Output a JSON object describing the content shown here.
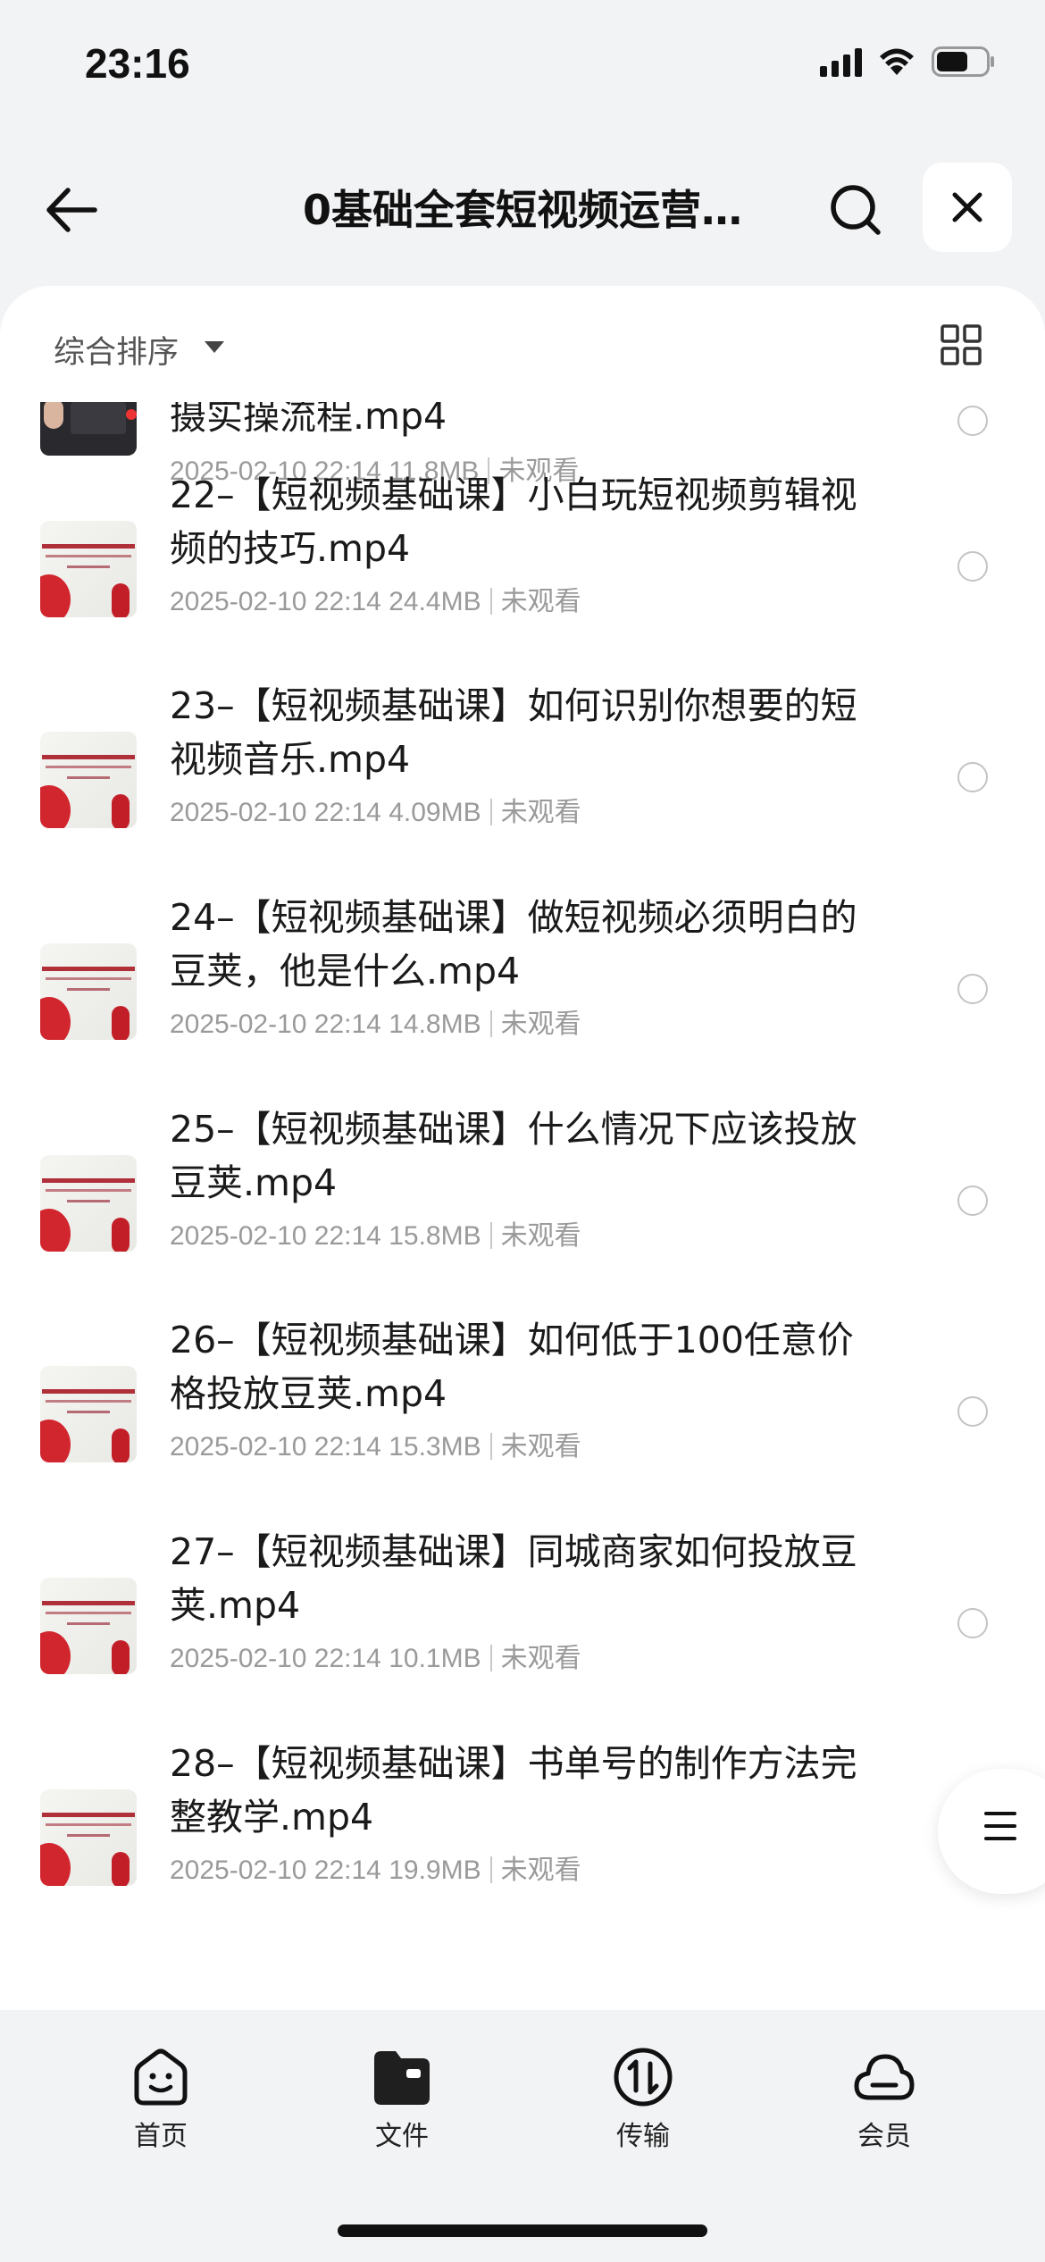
{
  "status_bar": {
    "time": "23:16"
  },
  "nav": {
    "title": "0基础全套短视频运营…",
    "back_icon": "arrow-left-icon",
    "search_icon": "search-icon",
    "close_icon": "close-icon"
  },
  "sort": {
    "label": "综合排序",
    "view_icon": "grid-view-icon"
  },
  "files": [
    {
      "name": "摄实操流程.mp4",
      "date": "2025-02-10 22:14",
      "size": "11.8MB",
      "status": "未观看"
    },
    {
      "name": "22–【短视频基础课】小白玩短视频剪辑视频的技巧.mp4",
      "date": "2025-02-10 22:14",
      "size": "24.4MB",
      "status": "未观看"
    },
    {
      "name": "23–【短视频基础课】如何识别你想要的短视频音乐.mp4",
      "date": "2025-02-10 22:14",
      "size": "4.09MB",
      "status": "未观看"
    },
    {
      "name": "24–【短视频基础课】做短视频必须明白的豆荚，他是什么.mp4",
      "date": "2025-02-10 22:14",
      "size": "14.8MB",
      "status": "未观看"
    },
    {
      "name": "25–【短视频基础课】什么情况下应该投放豆荚.mp4",
      "date": "2025-02-10 22:14",
      "size": "15.8MB",
      "status": "未观看"
    },
    {
      "name": "26–【短视频基础课】如何低于100任意价格投放豆荚.mp4",
      "date": "2025-02-10 22:14",
      "size": "15.3MB",
      "status": "未观看"
    },
    {
      "name": "27–【短视频基础课】同城商家如何投放豆荚.mp4",
      "date": "2025-02-10 22:14",
      "size": "10.1MB",
      "status": "未观看"
    },
    {
      "name": "28–【短视频基础课】书单号的制作方法完整教学.mp4",
      "date": "2025-02-10 22:14",
      "size": "19.9MB",
      "status": "未观看"
    }
  ],
  "tabbar": {
    "items": [
      {
        "label": "首页",
        "icon": "smiley-home-icon"
      },
      {
        "label": "文件",
        "icon": "folder-icon"
      },
      {
        "label": "传输",
        "icon": "transfer-icon"
      },
      {
        "label": "会员",
        "icon": "cloud-icon"
      }
    ]
  }
}
